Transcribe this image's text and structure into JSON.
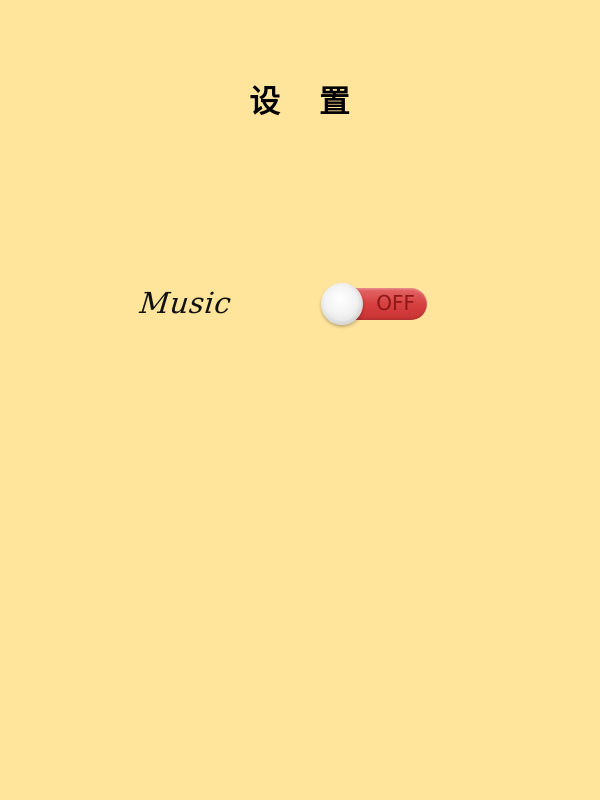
{
  "header": {
    "title": "设 置"
  },
  "settings": {
    "music": {
      "label": "Music",
      "state": "OFF"
    }
  },
  "colors": {
    "background": "#ffe59b",
    "toggle_off": "#d64040",
    "toggle_text": "#8f1717"
  }
}
